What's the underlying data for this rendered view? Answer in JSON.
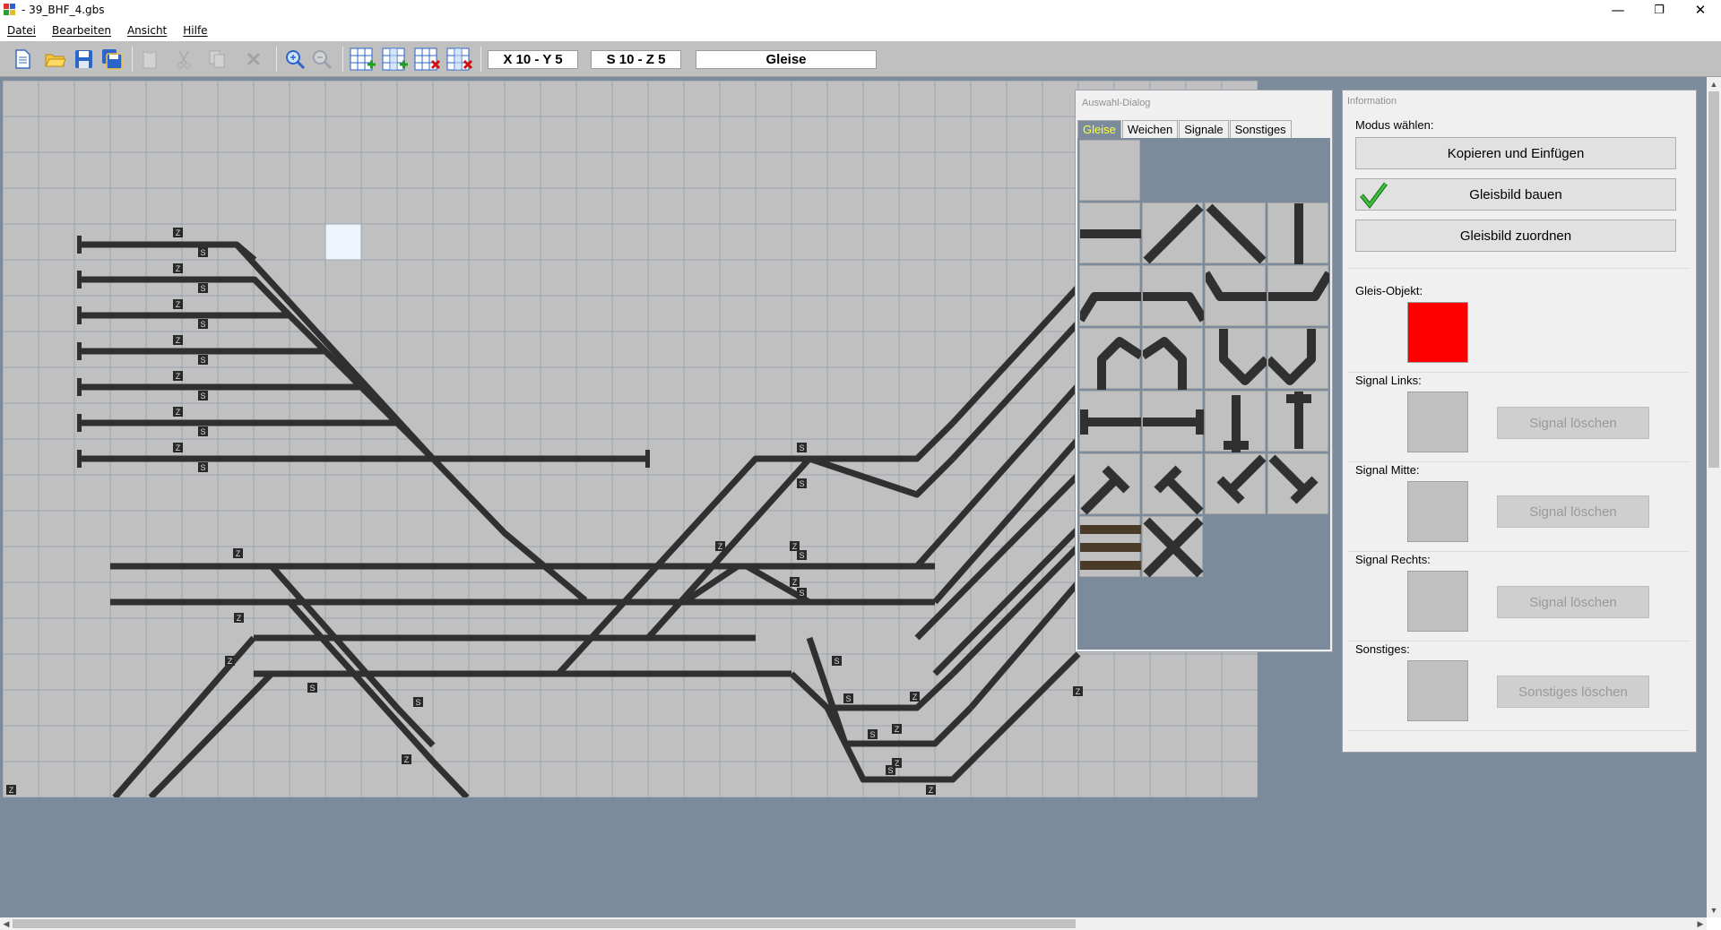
{
  "window": {
    "title": "- 39_BHF_4.gbs",
    "minimize_glyph": "—",
    "maximize_glyph": "❐",
    "close_glyph": "✕"
  },
  "menu": {
    "items": [
      "Datei",
      "Bearbeiten",
      "Ansicht",
      "Hilfe"
    ]
  },
  "toolbar": {
    "icons": [
      "new-document-icon",
      "open-folder-icon",
      "save-icon",
      "save-all-icon",
      "paste-icon",
      "cut-icon",
      "copy-icon",
      "delete-icon",
      "zoom-in-icon",
      "zoom-out-icon",
      "insert-row-icon",
      "insert-column-icon",
      "delete-row-icon",
      "delete-column-icon"
    ],
    "position_label": "X 10  -  Y 5",
    "section_label": "S 10  -  Z  5",
    "mode_label": "Gleise"
  },
  "auswahl_dialog": {
    "title": "Auswahl-Dialog",
    "tabs": [
      "Gleise",
      "Weichen",
      "Signale",
      "Sonstiges"
    ],
    "active_tab": "Gleise",
    "tile_names": [
      "empty-tile",
      "straight-horizontal",
      "diagonal-up",
      "diagonal-down",
      "straight-vertical",
      "curve-up-right",
      "curve-up-left",
      "curve-down-right",
      "curve-down-left",
      "arch-left",
      "arch-right",
      "curve-v-left",
      "curve-v-right",
      "buffer-left",
      "buffer-right",
      "buffer-top",
      "buffer-bottom",
      "tee-diagonal-1",
      "tee-diagonal-2",
      "tee-diagonal-3",
      "tee-diagonal-4",
      "platform-tracks",
      "crossing"
    ]
  },
  "info_panel": {
    "title": "Information",
    "mode_label": "Modus wählen:",
    "buttons": {
      "copy_paste": "Kopieren und Einfügen",
      "build": "Gleisbild bauen",
      "assign": "Gleisbild zuordnen"
    },
    "active_mode": "Gleisbild bauen",
    "gleis_objekt_label": "Gleis-Objekt:",
    "gleis_objekt_color": "#ff0000",
    "signal_links_label": "Signal Links:",
    "signal_mitte_label": "Signal Mitte:",
    "signal_rechts_label": "Signal Rechts:",
    "sonstiges_label": "Sonstiges:",
    "signal_delete": "Signal löschen",
    "sonstiges_delete": "Sonstiges löschen"
  },
  "colors": {
    "workspace_bg": "#7b8b9b",
    "grid_bg": "#c0c0c0",
    "grid_line": "#9aa6b2",
    "track": "#303030",
    "selected_cell": "#eef4fc",
    "active_tab_text": "#ffff40"
  },
  "track_markers": {
    "z": "Z",
    "s": "S"
  }
}
